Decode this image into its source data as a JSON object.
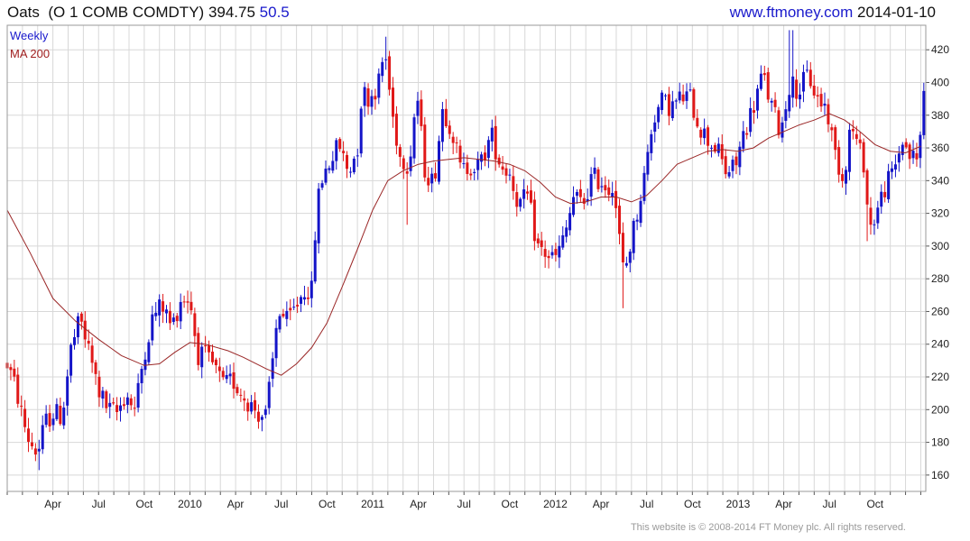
{
  "header": {
    "symbol": "Oats",
    "description": "(O 1 COMB COMDTY)",
    "price": "394.75",
    "change": "50.5",
    "site": "www.ftmoney.com",
    "date": "2014-01-10"
  },
  "legend": {
    "frequency": "Weekly",
    "ma_label": "MA 200",
    "frequency_color": "#1a1acc",
    "ma_color": "#a02020"
  },
  "footer": {
    "copyright": "This website is © 2008-2014 FT Money plc. All rights reserved."
  },
  "colors": {
    "up": "#1414c8",
    "down": "#e01818",
    "ma": "#9a2626",
    "grid": "#d8d8d8",
    "border": "#9a9a9a"
  },
  "chart_data": {
    "type": "candlestick",
    "ylim": [
      150,
      435
    ],
    "y_ticks": [
      160,
      180,
      200,
      220,
      240,
      260,
      280,
      300,
      320,
      340,
      360,
      380,
      400,
      420
    ],
    "x_ticks": [
      {
        "label": "Apr",
        "month": 3
      },
      {
        "label": "Jul",
        "month": 6
      },
      {
        "label": "Oct",
        "month": 9
      },
      {
        "label": "2010",
        "month": 12
      },
      {
        "label": "Apr",
        "month": 15
      },
      {
        "label": "Jul",
        "month": 18
      },
      {
        "label": "Oct",
        "month": 21
      },
      {
        "label": "2011",
        "month": 24
      },
      {
        "label": "Apr",
        "month": 27
      },
      {
        "label": "Jul",
        "month": 30
      },
      {
        "label": "Oct",
        "month": 33
      },
      {
        "label": "2012",
        "month": 36
      },
      {
        "label": "Apr",
        "month": 39
      },
      {
        "label": "Jul",
        "month": 42
      },
      {
        "label": "Oct",
        "month": 45
      },
      {
        "label": "2013",
        "month": 48
      },
      {
        "label": "Apr",
        "month": 51
      },
      {
        "label": "Jul",
        "month": 54
      },
      {
        "label": "Oct",
        "month": 57
      }
    ],
    "x_range_months": [
      0,
      60.33
    ],
    "ma_series": [
      [
        0.0,
        322
      ],
      [
        1.5,
        296
      ],
      [
        3.0,
        268
      ],
      [
        4.5,
        254
      ],
      [
        6.0,
        243
      ],
      [
        7.5,
        233
      ],
      [
        9.0,
        227
      ],
      [
        10.0,
        228
      ],
      [
        11.0,
        235
      ],
      [
        12.0,
        241
      ],
      [
        13.0,
        240
      ],
      [
        14.5,
        236
      ],
      [
        15.5,
        232
      ],
      [
        17.0,
        225
      ],
      [
        18.0,
        221
      ],
      [
        19.0,
        228
      ],
      [
        20.0,
        238
      ],
      [
        21.0,
        253
      ],
      [
        22.0,
        275
      ],
      [
        23.0,
        298
      ],
      [
        24.0,
        322
      ],
      [
        25.0,
        340
      ],
      [
        26.0,
        346
      ],
      [
        27.0,
        350
      ],
      [
        28.0,
        352
      ],
      [
        29.0,
        353
      ],
      [
        30.0,
        354
      ],
      [
        31.0,
        353
      ],
      [
        32.0,
        352
      ],
      [
        33.0,
        350
      ],
      [
        34.0,
        346
      ],
      [
        35.0,
        339
      ],
      [
        36.0,
        330
      ],
      [
        37.0,
        326
      ],
      [
        38.0,
        327
      ],
      [
        39.0,
        330
      ],
      [
        40.0,
        330
      ],
      [
        41.0,
        327
      ],
      [
        42.0,
        331
      ],
      [
        43.0,
        340
      ],
      [
        44.0,
        350
      ],
      [
        45.0,
        354
      ],
      [
        46.0,
        358
      ],
      [
        47.0,
        359
      ],
      [
        48.0,
        358
      ],
      [
        49.0,
        360
      ],
      [
        50.0,
        366
      ],
      [
        51.0,
        370
      ],
      [
        52.0,
        374
      ],
      [
        53.0,
        377
      ],
      [
        54.0,
        381
      ],
      [
        55.0,
        377
      ],
      [
        56.0,
        370
      ],
      [
        57.0,
        362
      ],
      [
        58.0,
        358
      ],
      [
        59.0,
        357
      ],
      [
        60.0,
        361
      ]
    ],
    "anchors": [
      [
        0.0,
        228
      ],
      [
        0.6,
        212
      ],
      [
        1.0,
        195
      ],
      [
        1.4,
        182
      ],
      [
        2.0,
        173
      ],
      [
        2.5,
        192
      ],
      [
        3.0,
        198
      ],
      [
        3.6,
        196
      ],
      [
        4.2,
        238
      ],
      [
        4.8,
        255
      ],
      [
        5.3,
        238
      ],
      [
        6.0,
        212
      ],
      [
        6.6,
        200
      ],
      [
        7.2,
        198
      ],
      [
        7.8,
        210
      ],
      [
        8.4,
        200
      ],
      [
        9.0,
        235
      ],
      [
        9.6,
        258
      ],
      [
        10.2,
        264
      ],
      [
        10.8,
        250
      ],
      [
        11.4,
        268
      ],
      [
        12.0,
        268
      ],
      [
        12.5,
        234
      ],
      [
        13.0,
        232
      ],
      [
        13.6,
        226
      ],
      [
        14.2,
        214
      ],
      [
        14.8,
        218
      ],
      [
        15.4,
        210
      ],
      [
        16.0,
        203
      ],
      [
        16.6,
        197
      ],
      [
        17.0,
        196
      ],
      [
        17.4,
        226
      ],
      [
        17.8,
        262
      ],
      [
        18.4,
        253
      ],
      [
        19.0,
        264
      ],
      [
        19.6,
        275
      ],
      [
        20.0,
        272
      ],
      [
        20.3,
        320
      ],
      [
        20.6,
        340
      ],
      [
        21.2,
        352
      ],
      [
        21.8,
        362
      ],
      [
        22.4,
        345
      ],
      [
        23.0,
        360
      ],
      [
        23.3,
        395
      ],
      [
        23.8,
        390
      ],
      [
        24.4,
        400
      ],
      [
        24.8,
        420
      ],
      [
        25.3,
        380
      ],
      [
        25.8,
        355
      ],
      [
        26.4,
        350
      ],
      [
        26.9,
        395
      ],
      [
        27.4,
        348
      ],
      [
        28.0,
        338
      ],
      [
        28.6,
        385
      ],
      [
        29.2,
        372
      ],
      [
        29.8,
        345
      ],
      [
        30.4,
        350
      ],
      [
        31.0,
        348
      ],
      [
        31.8,
        368
      ],
      [
        32.4,
        350
      ],
      [
        33.0,
        345
      ],
      [
        33.6,
        325
      ],
      [
        34.2,
        330
      ],
      [
        34.8,
        300
      ],
      [
        35.4,
        295
      ],
      [
        36.0,
        292
      ],
      [
        36.6,
        305
      ],
      [
        37.2,
        330
      ],
      [
        37.8,
        325
      ],
      [
        38.4,
        342
      ],
      [
        39.0,
        340
      ],
      [
        39.5,
        335
      ],
      [
        39.8,
        340
      ],
      [
        40.2,
        305
      ],
      [
        40.5,
        282
      ],
      [
        40.9,
        300
      ],
      [
        41.4,
        322
      ],
      [
        41.9,
        345
      ],
      [
        42.4,
        378
      ],
      [
        43.0,
        388
      ],
      [
        43.6,
        385
      ],
      [
        44.2,
        390
      ],
      [
        44.8,
        392
      ],
      [
        45.4,
        375
      ],
      [
        46.0,
        365
      ],
      [
        46.6,
        360
      ],
      [
        47.2,
        345
      ],
      [
        47.8,
        348
      ],
      [
        48.4,
        370
      ],
      [
        49.0,
        385
      ],
      [
        49.6,
        405
      ],
      [
        50.2,
        385
      ],
      [
        50.8,
        370
      ],
      [
        51.4,
        400
      ],
      [
        52.0,
        395
      ],
      [
        52.6,
        405
      ],
      [
        53.2,
        390
      ],
      [
        53.8,
        385
      ],
      [
        54.3,
        360
      ],
      [
        54.9,
        340
      ],
      [
        55.4,
        375
      ],
      [
        55.9,
        360
      ],
      [
        56.3,
        350
      ],
      [
        56.6,
        310
      ],
      [
        57.0,
        318
      ],
      [
        57.6,
        335
      ],
      [
        58.2,
        345
      ],
      [
        58.8,
        365
      ],
      [
        59.3,
        355
      ],
      [
        59.8,
        352
      ],
      [
        60.2,
        393
      ]
    ],
    "extremes": [
      [
        2.1,
        163
      ],
      [
        26.2,
        313
      ],
      [
        40.4,
        262
      ],
      [
        56.5,
        303
      ],
      [
        51.5,
        432
      ],
      [
        24.9,
        428
      ]
    ]
  }
}
